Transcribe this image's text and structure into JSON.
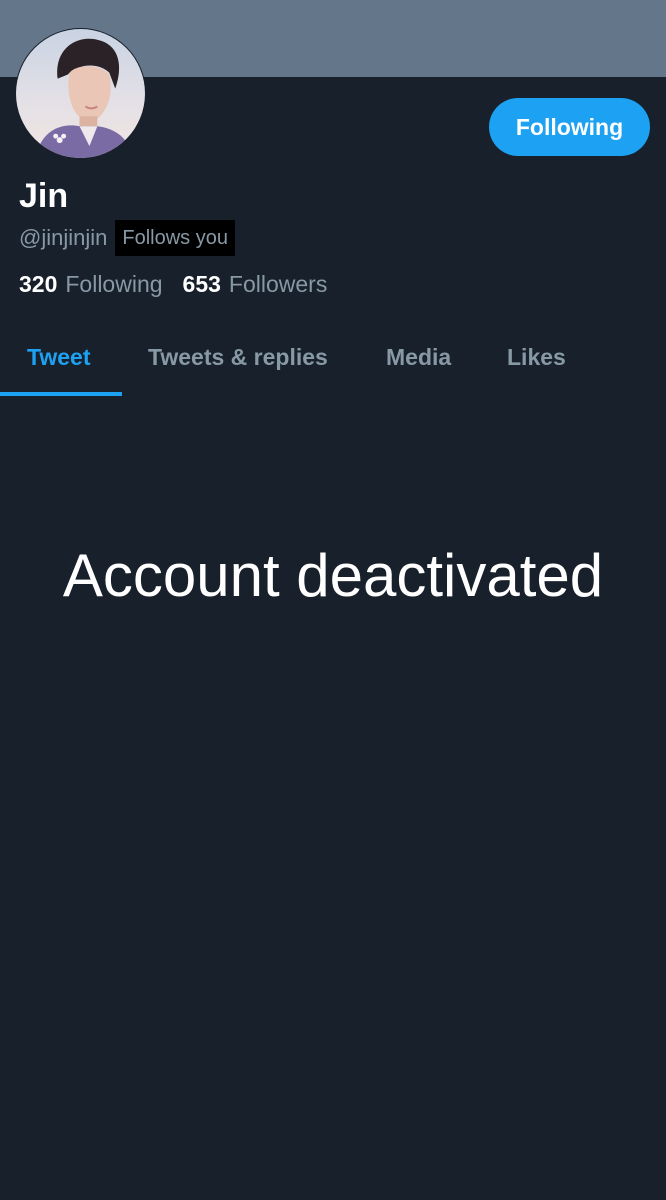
{
  "banner": {
    "color": "#64778a"
  },
  "profile": {
    "display_name": "Jin",
    "handle": "@jinjinjin",
    "follows_you": "Follows you",
    "follow_button_label": "Following"
  },
  "stats": {
    "following_count": "320",
    "following_label": "Following",
    "followers_count": "653",
    "followers_label": "Followers"
  },
  "tabs": [
    {
      "label": "Tweet",
      "active": true
    },
    {
      "label": "Tweets & replies",
      "active": false
    },
    {
      "label": "Media",
      "active": false
    },
    {
      "label": "Likes",
      "active": false
    }
  ],
  "main": {
    "status_message": "Account deactivated"
  },
  "colors": {
    "background": "#18202b",
    "accent": "#1da1f2",
    "muted_text": "#8899a6",
    "primary_text": "#ffffff"
  }
}
